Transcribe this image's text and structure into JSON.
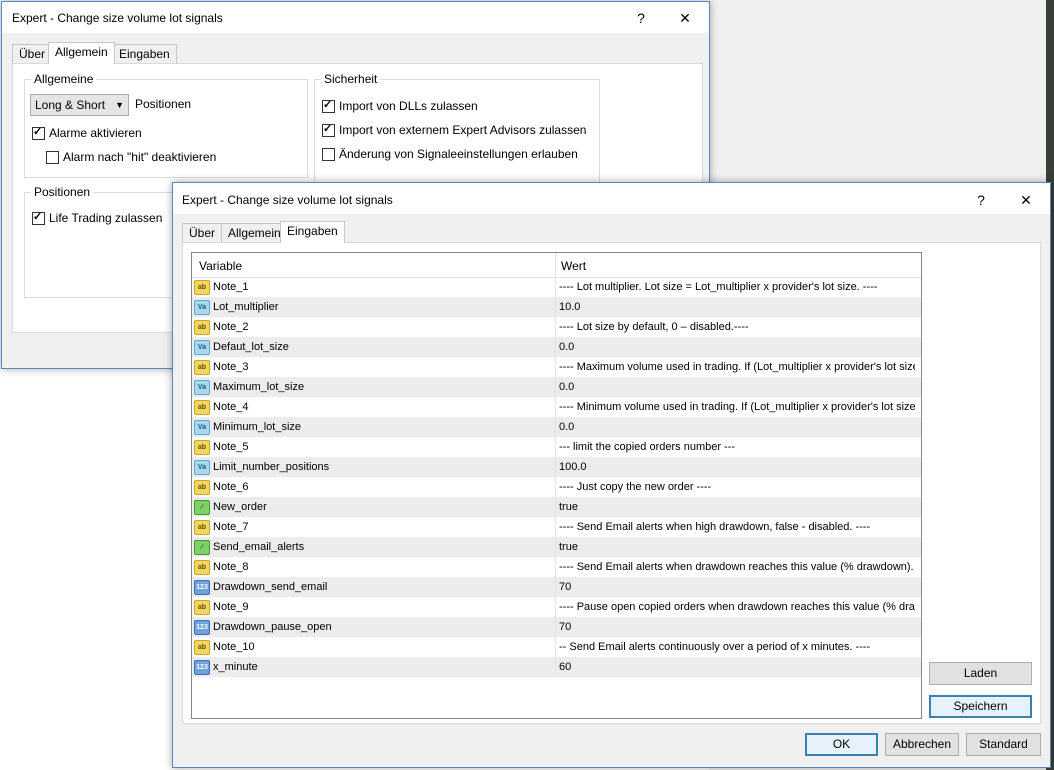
{
  "back_dialog": {
    "title": "Expert - Change size volume lot signals",
    "help_label": "?",
    "close_label": "✕",
    "tabs": [
      "Über",
      "Allgemein",
      "Eingaben"
    ],
    "active_tab": "Allgemein",
    "group_general": {
      "title": "Allgemeine",
      "positions_select_value": "Long & Short",
      "positions_label": "Positionen",
      "alerts_label": "Alarme aktivieren",
      "alerts_checked": true,
      "alarm_hit_label": "Alarm nach \"hit\" deaktivieren",
      "alarm_hit_checked": false
    },
    "group_security": {
      "title": "Sicherheit",
      "dll_label": "Import von DLLs zulassen",
      "dll_checked": true,
      "ea_label": "Import von externem Expert Advisors zulassen",
      "ea_checked": true,
      "signal_label": "Änderung von Signaleeinstellungen erlauben",
      "signal_checked": false
    },
    "group_positions": {
      "title": "Positionen",
      "live_label": "Life Trading zulassen",
      "live_checked": true
    }
  },
  "front_dialog": {
    "title": "Expert - Change size volume lot signals",
    "help_label": "?",
    "close_label": "✕",
    "tabs": [
      "Über",
      "Allgemein",
      "Eingaben"
    ],
    "active_tab": "Eingaben",
    "grid": {
      "columns": [
        "Variable",
        "Wert"
      ],
      "rows": [
        {
          "icon": "ab",
          "variable": "Note_1",
          "value": "---- Lot multiplier. Lot size = Lot_multiplier x provider's lot size. ----"
        },
        {
          "icon": "va",
          "variable": "Lot_multiplier",
          "value": "10.0"
        },
        {
          "icon": "ab",
          "variable": "Note_2",
          "value": "---- Lot size by default, 0 – disabled.----"
        },
        {
          "icon": "va",
          "variable": "Defaut_lot_size",
          "value": "0.0"
        },
        {
          "icon": "ab",
          "variable": "Note_3",
          "value": "---- Maximum volume used in trading. If (Lot_multiplier x provider's lot size) ..."
        },
        {
          "icon": "va",
          "variable": "Maximum_lot_size",
          "value": "0.0"
        },
        {
          "icon": "ab",
          "variable": "Note_4",
          "value": "---- Minimum volume used in trading. If (Lot_multiplier x provider's lot size) <..."
        },
        {
          "icon": "va",
          "variable": "Minimum_lot_size",
          "value": "0.0"
        },
        {
          "icon": "ab",
          "variable": "Note_5",
          "value": "--- limit the copied orders number ---"
        },
        {
          "icon": "va",
          "variable": "Limit_number_positions",
          "value": "100.0"
        },
        {
          "icon": "ab",
          "variable": "Note_6",
          "value": "---- Just copy the new order ----"
        },
        {
          "icon": "bool",
          "variable": "New_order",
          "value": "true"
        },
        {
          "icon": "ab",
          "variable": "Note_7",
          "value": "---- Send Email alerts when high drawdown, false - disabled. ----"
        },
        {
          "icon": "bool",
          "variable": "Send_email_alerts",
          "value": "true"
        },
        {
          "icon": "ab",
          "variable": "Note_8",
          "value": "---- Send Email alerts when drawdown reaches this value (% drawdown). ----"
        },
        {
          "icon": "123",
          "variable": "Drawdown_send_email",
          "value": "70"
        },
        {
          "icon": "ab",
          "variable": "Note_9",
          "value": "---- Pause open copied orders when drawdown reaches this value (% dra..."
        },
        {
          "icon": "123",
          "variable": "Drawdown_pause_open",
          "value": "70"
        },
        {
          "icon": "ab",
          "variable": "Note_10",
          "value": "-- Send Email alerts continuously over a period of x minutes. ----"
        },
        {
          "icon": "123",
          "variable": "x_minute",
          "value": "60"
        }
      ]
    },
    "buttons": {
      "load": "Laden",
      "save": "Speichern",
      "ok": "OK",
      "cancel": "Abbrechen",
      "default": "Standard"
    }
  },
  "icon_labels": {
    "ab": "ab",
    "va": "Va",
    "bool": "⁄",
    "123": "123"
  }
}
